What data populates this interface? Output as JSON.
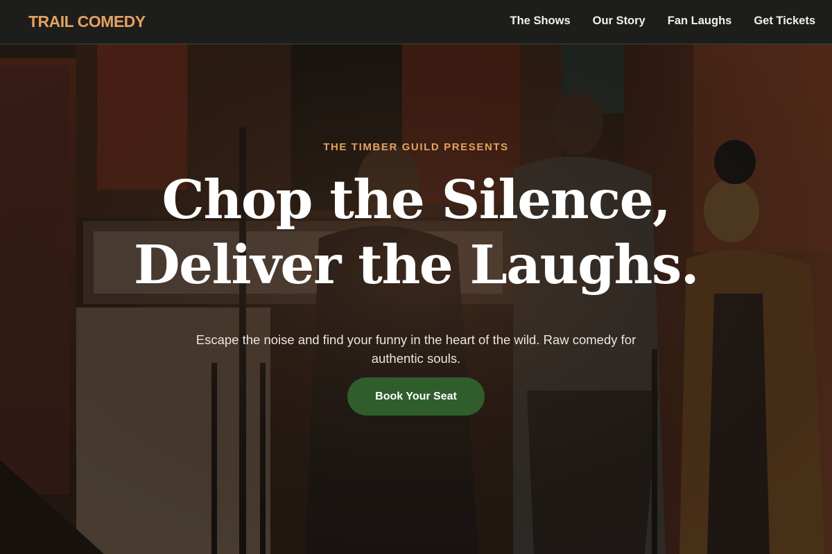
{
  "brand": {
    "name": "TRAIL COMEDY"
  },
  "nav": {
    "items": [
      {
        "label": "The Shows"
      },
      {
        "label": "Our Story"
      },
      {
        "label": "Fan Laughs"
      },
      {
        "label": "Get Tickets"
      }
    ]
  },
  "hero": {
    "kicker": "THE TIMBER GUILD PRESENTS",
    "headline_line1": "Chop the Silence,",
    "headline_line2": "Deliver the Laughs.",
    "subtitle": "Escape the noise and find your funny in the heart of the wild. Raw comedy for authentic souls.",
    "cta_label": "Book Your Seat"
  },
  "colors": {
    "accent": "#e3a25f",
    "cta_background": "#2f5e2c",
    "nav_background": "#1d1d1c"
  }
}
